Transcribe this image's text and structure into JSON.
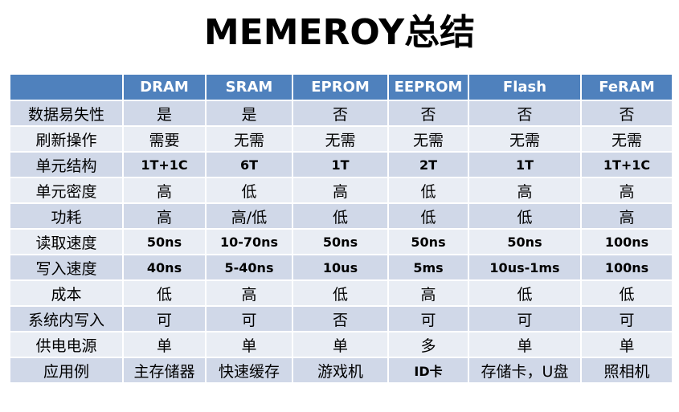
{
  "title": "MEMEROY总结",
  "colors": {
    "header_bg": "#4f81bd",
    "row_dark": "#d0d8e8",
    "row_light": "#e9edf4",
    "header_text": "#ffffff",
    "body_text": "#000000"
  },
  "table": {
    "columns": [
      "",
      "DRAM",
      "SRAM",
      "EPROM",
      "EEPROM",
      "Flash",
      "FeRAM"
    ],
    "rows": [
      {
        "label": "数据易失性",
        "cells": [
          "是",
          "是",
          "否",
          "否",
          "否",
          "否"
        ]
      },
      {
        "label": "刷新操作",
        "cells": [
          "需要",
          "无需",
          "无需",
          "无需",
          "无需",
          "无需"
        ]
      },
      {
        "label": "单元结构",
        "cells": [
          "1T+1C",
          "6T",
          "1T",
          "2T",
          "1T",
          "1T+1C"
        ]
      },
      {
        "label": "单元密度",
        "cells": [
          "高",
          "低",
          "高",
          "低",
          "高",
          "高"
        ]
      },
      {
        "label": "功耗",
        "cells": [
          "高",
          "高/低",
          "低",
          "低",
          "低",
          "高"
        ]
      },
      {
        "label": "读取速度",
        "cells": [
          "50ns",
          "10-70ns",
          "50ns",
          "50ns",
          "50ns",
          "100ns"
        ]
      },
      {
        "label": "写入速度",
        "cells": [
          "40ns",
          "5-40ns",
          "10us",
          "5ms",
          "10us-1ms",
          "100ns"
        ]
      },
      {
        "label": "成本",
        "cells": [
          "低",
          "高",
          "低",
          "高",
          "低",
          "低"
        ]
      },
      {
        "label": "系统内写入",
        "cells": [
          "可",
          "可",
          "否",
          "可",
          "可",
          "可"
        ]
      },
      {
        "label": "供电电源",
        "cells": [
          "单",
          "单",
          "单",
          "多",
          "单",
          "单"
        ]
      },
      {
        "label": "应用例",
        "cells": [
          "主存储器",
          "快速缓存",
          "游戏机",
          "ID卡",
          "存储卡，U盘",
          "照相机"
        ]
      }
    ]
  }
}
